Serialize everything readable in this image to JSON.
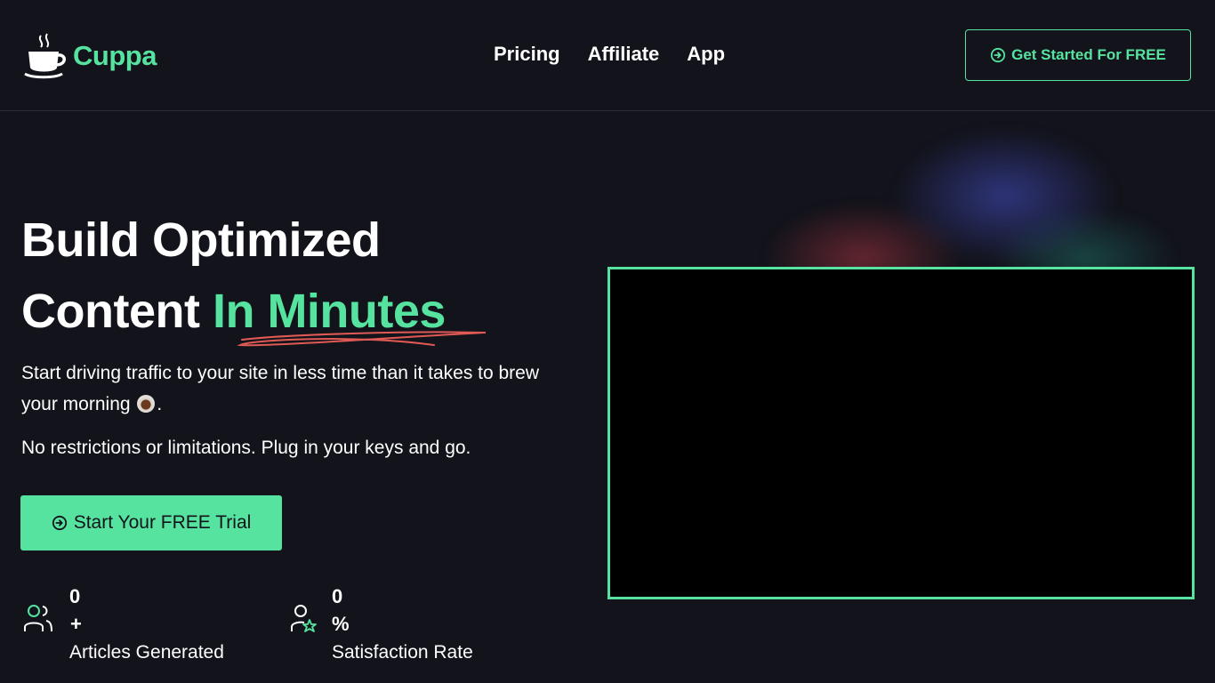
{
  "brand": {
    "name": "Cuppa",
    "logo_icon": "coffee-cup-icon",
    "accent_color": "#56e39f"
  },
  "nav": {
    "items": [
      {
        "label": "Pricing"
      },
      {
        "label": "Affiliate"
      },
      {
        "label": "App"
      }
    ]
  },
  "header_cta": {
    "label": "Get Started For FREE",
    "icon": "circle-arrow-right-icon"
  },
  "hero": {
    "title_line1": "Build Optimized",
    "title_line2_plain": "Content ",
    "title_line2_accent": "In Minutes",
    "subtitle_part1": "Start driving traffic to your site in less time than it takes to brew your morning",
    "subtitle_part2": ".",
    "subtitle_emoji": "coffee-cup-emoji",
    "note": "No restrictions or limitations. Plug in your keys and go.",
    "cta_label": "Start Your FREE Trial"
  },
  "stats": [
    {
      "value": "0",
      "suffix": "+",
      "label": "Articles Generated",
      "icon": "users-icon"
    },
    {
      "value": "0",
      "suffix": "%",
      "label": "Satisfaction Rate",
      "icon": "user-star-icon"
    }
  ],
  "colors": {
    "background": "#12131b",
    "accent": "#56e39f",
    "underline": "#e05a55"
  }
}
